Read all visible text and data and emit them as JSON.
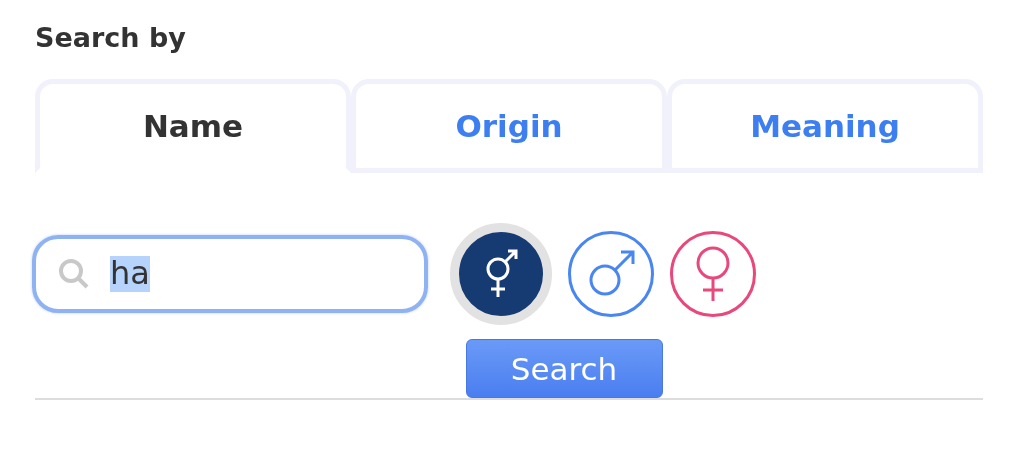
{
  "heading": "Search by",
  "tabs": [
    {
      "label": "Name",
      "selected": true
    },
    {
      "label": "Origin",
      "selected": false
    },
    {
      "label": "Meaning",
      "selected": false
    }
  ],
  "search": {
    "value": "ha",
    "value_selected": true
  },
  "genders": [
    {
      "kind": "both",
      "selected": true
    },
    {
      "kind": "male",
      "selected": false
    },
    {
      "kind": "female",
      "selected": false
    }
  ],
  "button": "Search"
}
